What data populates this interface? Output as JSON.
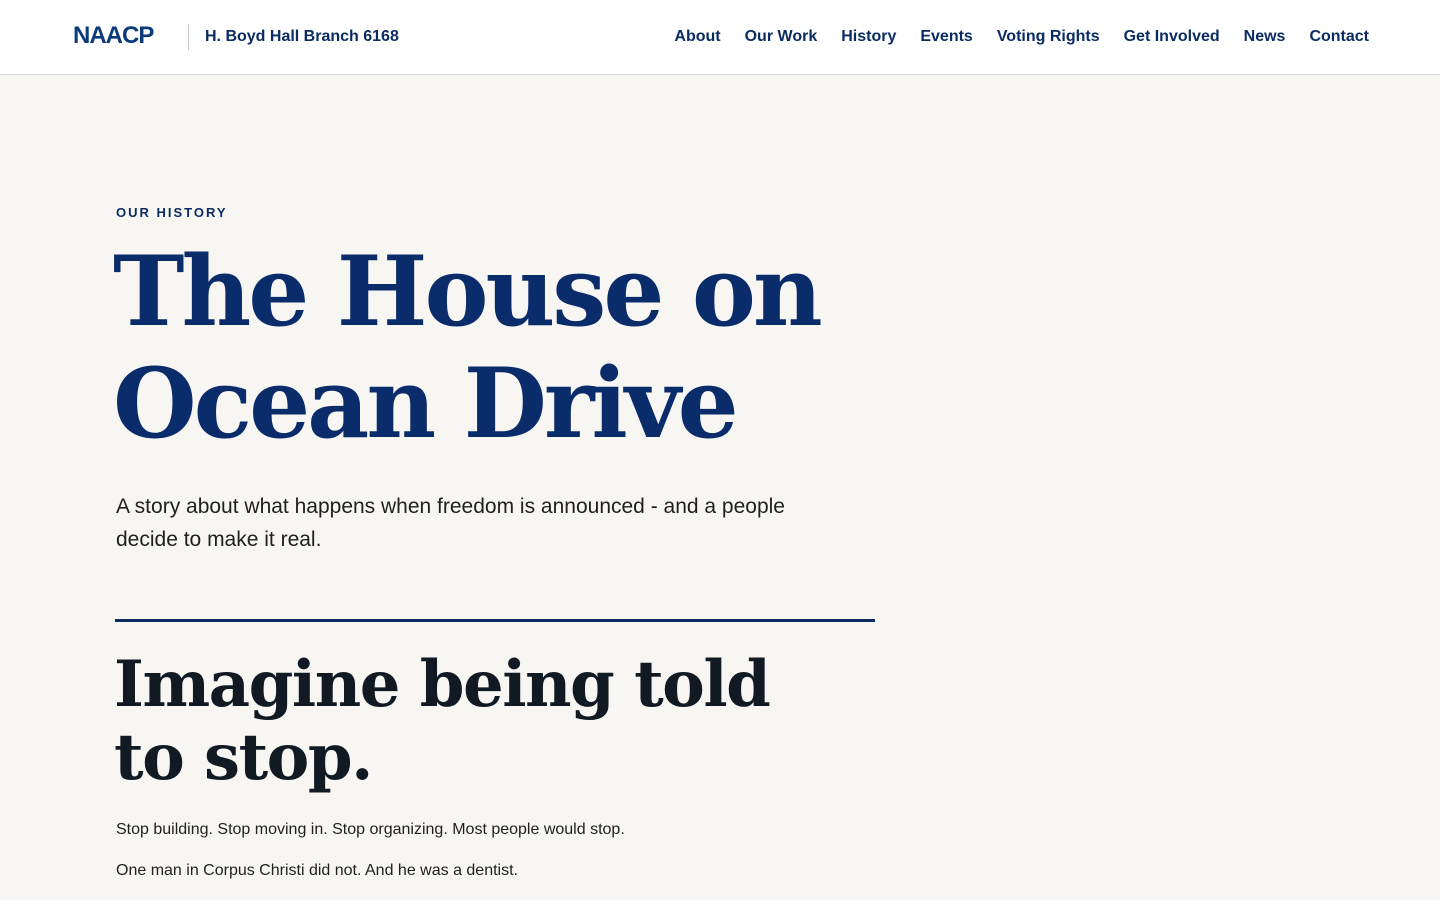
{
  "header": {
    "logo_text": "NAACP",
    "branch_name": "H. Boyd Hall Branch 6168",
    "nav": [
      {
        "label": "About"
      },
      {
        "label": "Our Work"
      },
      {
        "label": "History"
      },
      {
        "label": "Events"
      },
      {
        "label": "Voting Rights"
      },
      {
        "label": "Get Involved"
      },
      {
        "label": "News"
      },
      {
        "label": "Contact"
      }
    ]
  },
  "hero": {
    "eyebrow": "OUR HISTORY",
    "title_line1": "The House on",
    "title_line2": "Ocean Drive",
    "subtitle_line1": "A story about what happens when freedom is announced - and a people",
    "subtitle_line2": "decide to make it real."
  },
  "section": {
    "title_line1": "Imagine being told",
    "title_line2": "to stop.",
    "paragraphs": [
      "Stop building. Stop moving in. Stop organizing. Most people would stop.",
      "One man in Corpus Christi did not. And he was a dentist."
    ]
  },
  "colors": {
    "brand_navy": "#0b2c62",
    "page_background": "#f7f6f2",
    "header_background": "#ffffff",
    "heading_dark": "#111a22"
  }
}
